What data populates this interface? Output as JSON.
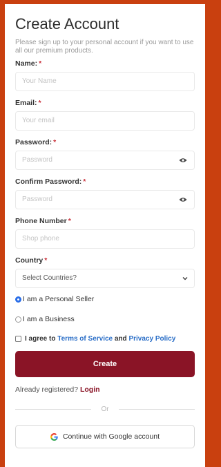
{
  "title": "Create Account",
  "subtitle": "Please sign up to your personal account if you want to use all our premium products.",
  "fields": {
    "name": {
      "label": "Name:",
      "required": "*",
      "placeholder": "Your Name"
    },
    "email": {
      "label": "Email:",
      "required": "*",
      "placeholder": "Your email"
    },
    "password": {
      "label": "Password:",
      "required": "*",
      "placeholder": "Password"
    },
    "confirm": {
      "label": "Confirm Password:",
      "required": "*",
      "placeholder": "Password"
    },
    "phone": {
      "label": "Phone Number",
      "required": "*",
      "placeholder": "Shop phone"
    },
    "country": {
      "label": "Country",
      "required": "*",
      "selected": "Select Countries?"
    }
  },
  "seller_type": {
    "personal": "I am a Personal Seller",
    "business": "I am a Business"
  },
  "agree": {
    "prefix": "I agree to",
    "terms": "Terms of Service",
    "and": "and",
    "privacy": "Privacy Policy"
  },
  "create_button": "Create",
  "already": {
    "text": "Already registered?",
    "login": "Login"
  },
  "divider": "Or",
  "google_button": "Continue with Google account",
  "colors": {
    "background": "#c9400f",
    "primary": "#8a1426",
    "link": "#2a6ec7",
    "required": "#c9303a"
  }
}
